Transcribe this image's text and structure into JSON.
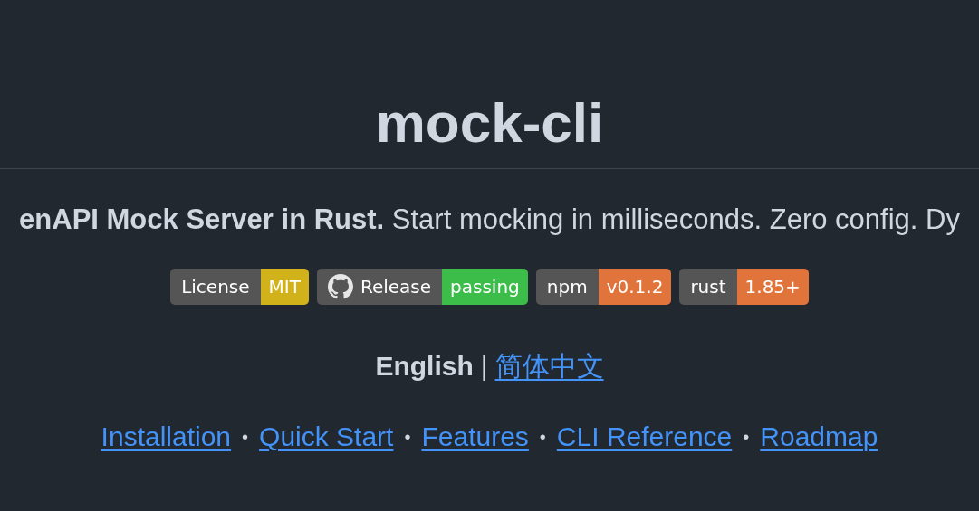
{
  "title": "mock-cli",
  "tagline": "**enAPI Mock Server in Rust.** Start mocking in milliseconds. Zero config. Dy",
  "badges": [
    {
      "label": "License",
      "message": "MIT",
      "color": "#d2b21b",
      "logo": false
    },
    {
      "label": "Release",
      "message": "passing",
      "color": "#3cbd4a",
      "logo": true
    },
    {
      "label": "npm",
      "message": "v0.1.2",
      "color": "#e0743a",
      "logo": false
    },
    {
      "label": "rust",
      "message": "1.85+",
      "color": "#e0743a",
      "logo": false
    }
  ],
  "language": [
    {
      "kind": "current",
      "text": "English"
    },
    {
      "kind": "separator",
      "text": "|"
    },
    {
      "kind": "link",
      "text": "简体中文"
    }
  ],
  "nav": [
    {
      "kind": "link",
      "text": "Installation"
    },
    {
      "kind": "separator",
      "text": "•"
    },
    {
      "kind": "link",
      "text": "Quick Start"
    },
    {
      "kind": "separator",
      "text": "•"
    },
    {
      "kind": "link",
      "text": "Features"
    },
    {
      "kind": "separator",
      "text": "•"
    },
    {
      "kind": "link",
      "text": "CLI Reference"
    },
    {
      "kind": "separator",
      "text": "•"
    },
    {
      "kind": "link",
      "text": "Roadmap"
    }
  ]
}
